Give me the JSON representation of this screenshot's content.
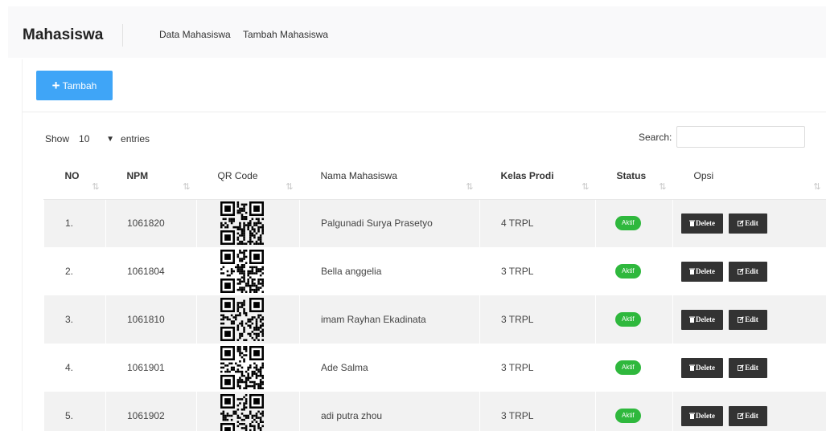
{
  "app": {
    "title": "Mahasiswa",
    "nav": [
      "Data Mahasiswa",
      "Tambah Mahasiswa"
    ]
  },
  "toolbar": {
    "add_label": "Tambah"
  },
  "datatable": {
    "show_label": "Show",
    "entries_value": "10",
    "entries_label": "entries",
    "search_label": "Search:",
    "search_value": "",
    "sort_icon": "⇅"
  },
  "table": {
    "headers": [
      "NO",
      "NPM",
      "QR Code",
      "Nama Mahasiswa",
      "Kelas Prodi",
      "Status",
      "Opsi"
    ],
    "rows": [
      {
        "no": "1.",
        "npm": "1061820",
        "nama": "Palgunadi Surya Prasetyo",
        "kelas": "4 TRPL",
        "status": "Aktif"
      },
      {
        "no": "2.",
        "npm": "1061804",
        "nama": "Bella anggelia",
        "kelas": "3 TRPL",
        "status": "Aktif"
      },
      {
        "no": "3.",
        "npm": "1061810",
        "nama": "imam Rayhan Ekadinata",
        "kelas": "3 TRPL",
        "status": "Aktif"
      },
      {
        "no": "4.",
        "npm": "1061901",
        "nama": "Ade Salma",
        "kelas": "3 TRPL",
        "status": "Aktif"
      },
      {
        "no": "5.",
        "npm": "1061902",
        "nama": "adi putra zhou",
        "kelas": "3 TRPL",
        "status": "Aktif"
      }
    ],
    "actions": {
      "delete_label": "Delete",
      "edit_label": "Edit"
    }
  },
  "colors": {
    "primary": "#3fa5f7",
    "success": "#2fb83d",
    "dark": "#333333",
    "stripe": "#f2f2f2"
  }
}
